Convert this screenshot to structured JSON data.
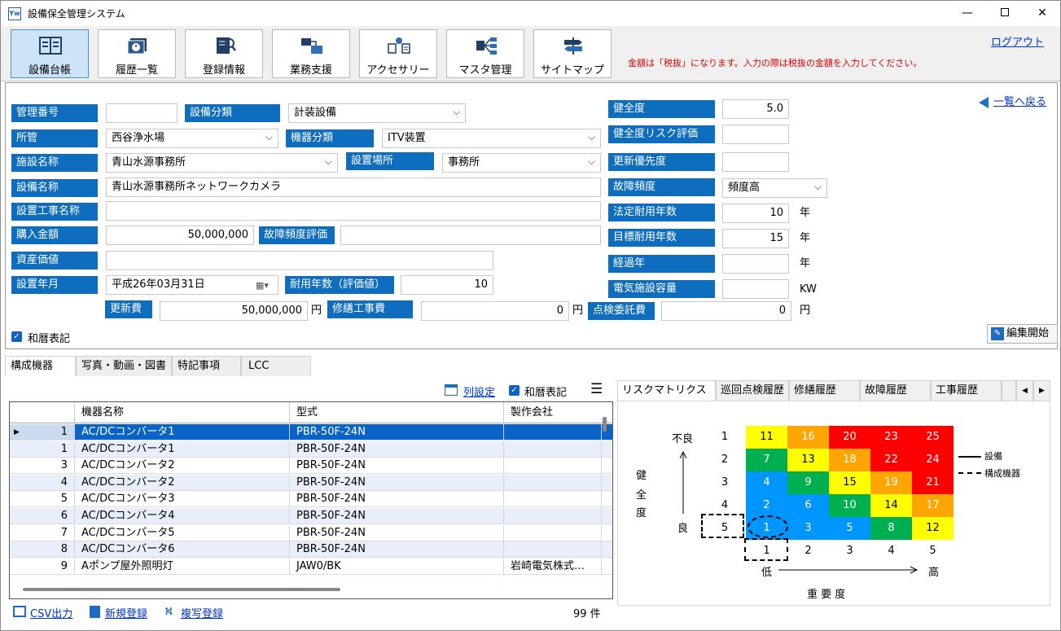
{
  "window": {
    "title": "設備保全管理システム",
    "icon_text": "Yw"
  },
  "colors": {
    "accent": "#0f6dbf",
    "link": "#0033cc",
    "notice": "#e00000"
  },
  "toolbar": {
    "buttons": [
      {
        "label": "設備台帳",
        "icon": "ledger-icon",
        "active": true
      },
      {
        "label": "履歴一覧",
        "icon": "history-icon",
        "active": false
      },
      {
        "label": "登録情報",
        "icon": "registration-icon",
        "active": false
      },
      {
        "label": "業務支援",
        "icon": "work-support-icon",
        "active": false
      },
      {
        "label": "アクセサリー",
        "icon": "accessory-icon",
        "active": false
      },
      {
        "label": "マスタ管理",
        "icon": "master-icon",
        "active": false
      },
      {
        "label": "サイトマップ",
        "icon": "sitemap-icon",
        "active": false
      }
    ],
    "logout": "ログアウト",
    "notice": "金額は「税抜」になります。入力の際は税抜の金額を入力してください。"
  },
  "form": {
    "back_link": "一覧へ戻る",
    "labels": {
      "kanri_bango": "管理番号",
      "setsubi_bunrui": "設備分類",
      "shokan": "所管",
      "kiki_bunrui": "機器分類",
      "shisetsu_meisho": "施設名称",
      "setchi_basho": "設置場所",
      "setsubi_meisho": "設備名称",
      "setchi_koji": "設置工事名称",
      "konyu_kingaku": "購入金額",
      "kosho_hindo_hyoka": "故障頻度評価",
      "shisan_kachi": "資産価値",
      "setchi_nengetsu": "設置年月",
      "taiyo_nensu": "耐用年数（評価値）",
      "koshinhi": "更新費",
      "shuzen_kojihi": "修繕工事費",
      "tenken_itakuhi": "点検委託費",
      "kenzendo": "健全度",
      "kenzendo_risk": "健全度リスク評価",
      "koshin_yusendo": "更新優先度",
      "kosho_hindo": "故障頻度",
      "hotei_taiyo": "法定耐用年数",
      "mokuhyo_taiyo": "目標耐用年数",
      "keika_nen": "経過年",
      "denki_yoryo": "電気施設容量"
    },
    "values": {
      "kanri_bango": "",
      "setsubi_bunrui": "計装設備",
      "shokan": "西谷浄水場",
      "kiki_bunrui": "ITV装置",
      "shisetsu_meisho": "青山水源事務所",
      "setchi_basho": "事務所",
      "setsubi_meisho": "青山水源事務所ネットワークカメラ",
      "setchi_koji": "",
      "konyu_kingaku": "50,000,000",
      "kosho_hindo_hyoka": "",
      "shisan_kachi": "",
      "setchi_nengetsu": "平成26年03月31日",
      "taiyo_nensu": "10",
      "koshinhi": "50,000,000",
      "shuzen_kojihi": "0",
      "tenken_itakuhi": "0",
      "kenzendo": "5.0",
      "kenzendo_risk": "",
      "koshin_yusendo": "",
      "kosho_hindo": "頻度高",
      "hotei_taiyo": "10",
      "mokuhyo_taiyo": "15",
      "keika_nen": "",
      "denki_yoryo": ""
    },
    "units": {
      "yen": "円",
      "year": "年",
      "kw": "KW"
    },
    "wareki_label": "和暦表記",
    "edit_button": "編集開始"
  },
  "lower_tabs": [
    "構成機器",
    "写真・動画・図書",
    "特記事項",
    "LCC"
  ],
  "grid": {
    "column_settings": "列設定",
    "wareki_label": "和暦表記",
    "columns": [
      "機器名称",
      "型式",
      "製作会社"
    ],
    "rows": [
      {
        "no": "1",
        "name": "AC/DCコンバータ1",
        "model": "PBR-50F-24N",
        "maker": ""
      },
      {
        "no": "1",
        "name": "AC/DCコンバータ1",
        "model": "PBR-50F-24N",
        "maker": ""
      },
      {
        "no": "3",
        "name": "AC/DCコンバータ2",
        "model": "PBR-50F-24N",
        "maker": ""
      },
      {
        "no": "4",
        "name": "AC/DCコンバータ2",
        "model": "PBR-50F-24N",
        "maker": ""
      },
      {
        "no": "5",
        "name": "AC/DCコンバータ3",
        "model": "PBR-50F-24N",
        "maker": ""
      },
      {
        "no": "6",
        "name": "AC/DCコンバータ4",
        "model": "PBR-50F-24N",
        "maker": ""
      },
      {
        "no": "7",
        "name": "AC/DCコンバータ5",
        "model": "PBR-50F-24N",
        "maker": ""
      },
      {
        "no": "8",
        "name": "AC/DCコンバータ6",
        "model": "PBR-50F-24N",
        "maker": ""
      },
      {
        "no": "9",
        "name": "Aポンプ屋外照明灯",
        "model": "JAW0/BK",
        "maker": "岩崎電気株式…"
      }
    ],
    "actions": {
      "csv": "CSV出力",
      "new": "新規登録",
      "copy": "複写登録"
    },
    "count": "99 件"
  },
  "right_tabs": [
    "リスクマトリクス",
    "巡回点検履歴",
    "修繕履歴",
    "故障履歴",
    "工事履歴"
  ],
  "risk_matrix": {
    "y_top": "不良",
    "y_bottom": "良",
    "y_title": [
      "健",
      "全",
      "度"
    ],
    "x_left": "低",
    "x_right": "高",
    "x_title": "重 要 度",
    "row_labels": [
      "1",
      "2",
      "3",
      "4",
      "5"
    ],
    "col_labels": [
      "1",
      "2",
      "3",
      "4",
      "5"
    ],
    "cells": [
      [
        "11",
        "16",
        "20",
        "23",
        "25"
      ],
      [
        "7",
        "13",
        "18",
        "22",
        "24"
      ],
      [
        "4",
        "9",
        "15",
        "19",
        "21"
      ],
      [
        "2",
        "6",
        "10",
        "14",
        "17"
      ],
      [
        "1",
        "3",
        "5",
        "8",
        "12"
      ]
    ],
    "cell_colors": [
      [
        "#ffff00",
        "#ffa500",
        "#ff0000",
        "#ff0000",
        "#ff0000"
      ],
      [
        "#00b050",
        "#ffff00",
        "#ffa500",
        "#ff0000",
        "#ff0000"
      ],
      [
        "#0096ff",
        "#00b050",
        "#ffff00",
        "#ffa500",
        "#ff0000"
      ],
      [
        "#0096ff",
        "#0096ff",
        "#00b050",
        "#ffff00",
        "#ffa500"
      ],
      [
        "#0096ff",
        "#0096ff",
        "#0096ff",
        "#00b050",
        "#ffff00"
      ]
    ],
    "legend": {
      "equipment": "設備",
      "component": "構成機器"
    }
  }
}
